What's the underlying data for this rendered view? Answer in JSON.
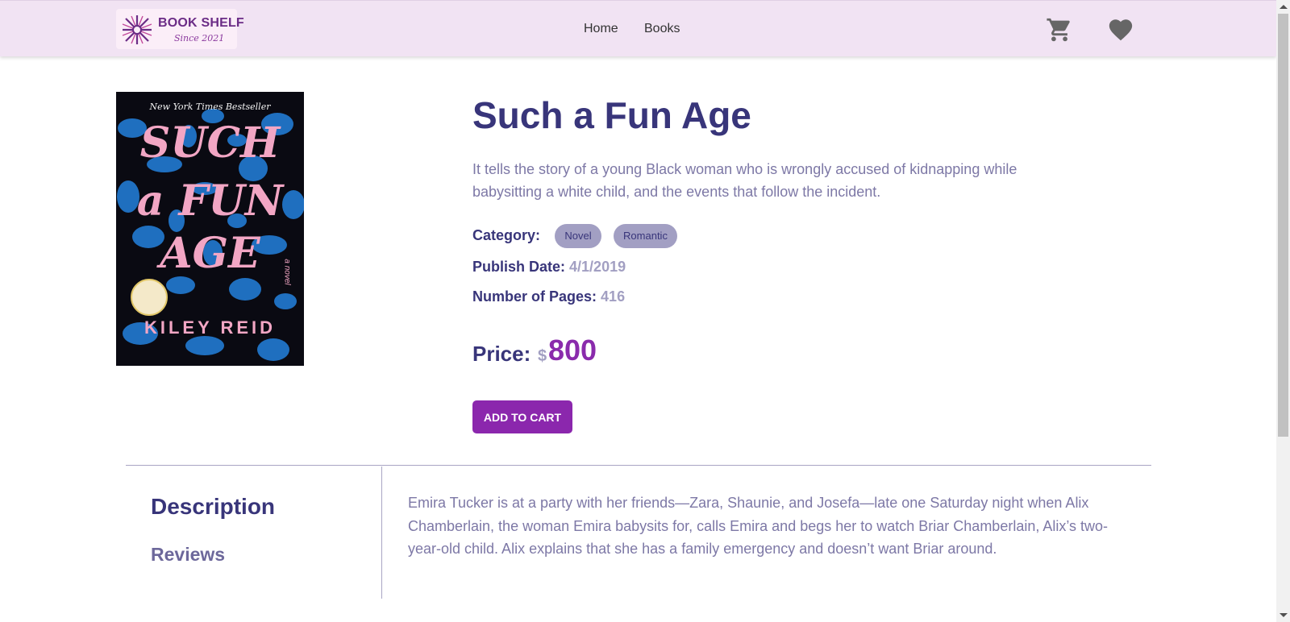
{
  "header": {
    "logo_title": "BOOK SHELF",
    "logo_subtitle": "Since 2021",
    "nav": [
      {
        "label": "Home"
      },
      {
        "label": "Books"
      }
    ],
    "cart_icon": "cart-icon",
    "wishlist_icon": "heart-icon",
    "icon_color": "#666666",
    "background_color": "#f1e3f3"
  },
  "book": {
    "cover": {
      "tagline": "New York Times Bestseller",
      "title_lines": [
        "SUCH",
        "a FUN",
        "AGE"
      ],
      "author": "KILEY REID",
      "subtitle": "a novel"
    },
    "title": "Such a Fun Age",
    "summary": "It tells the story of a young Black woman who is wrongly accused of kidnapping while babysitting a white child, and the events that follow the incident.",
    "category_label": "Category:",
    "categories": [
      "Novel",
      "Romantic"
    ],
    "publish_label": "Publish Date:",
    "publish_date": "4/1/2019",
    "pages_label": "Number of Pages:",
    "pages": "416",
    "price_label": "Price:",
    "currency": "$",
    "price": "800",
    "add_to_cart": "ADD TO CART"
  },
  "tabs": {
    "description": "Description",
    "reviews": "Reviews",
    "active": "description",
    "description_text": "Emira Tucker is at a party with her friends—Zara, Shaunie, and Josefa—late one Saturday night when Alix Chamberlain, the woman Emira babysits for, calls Emira and begs her to watch Briar Chamberlain, Alix’s two-year-old child. Alix explains that she has a family emergency and doesn’t want Briar around."
  },
  "colors": {
    "primary_text": "#38357a",
    "muted_text": "#7d78a6",
    "accent": "#8b27ad",
    "chip": "#a29fc3"
  }
}
